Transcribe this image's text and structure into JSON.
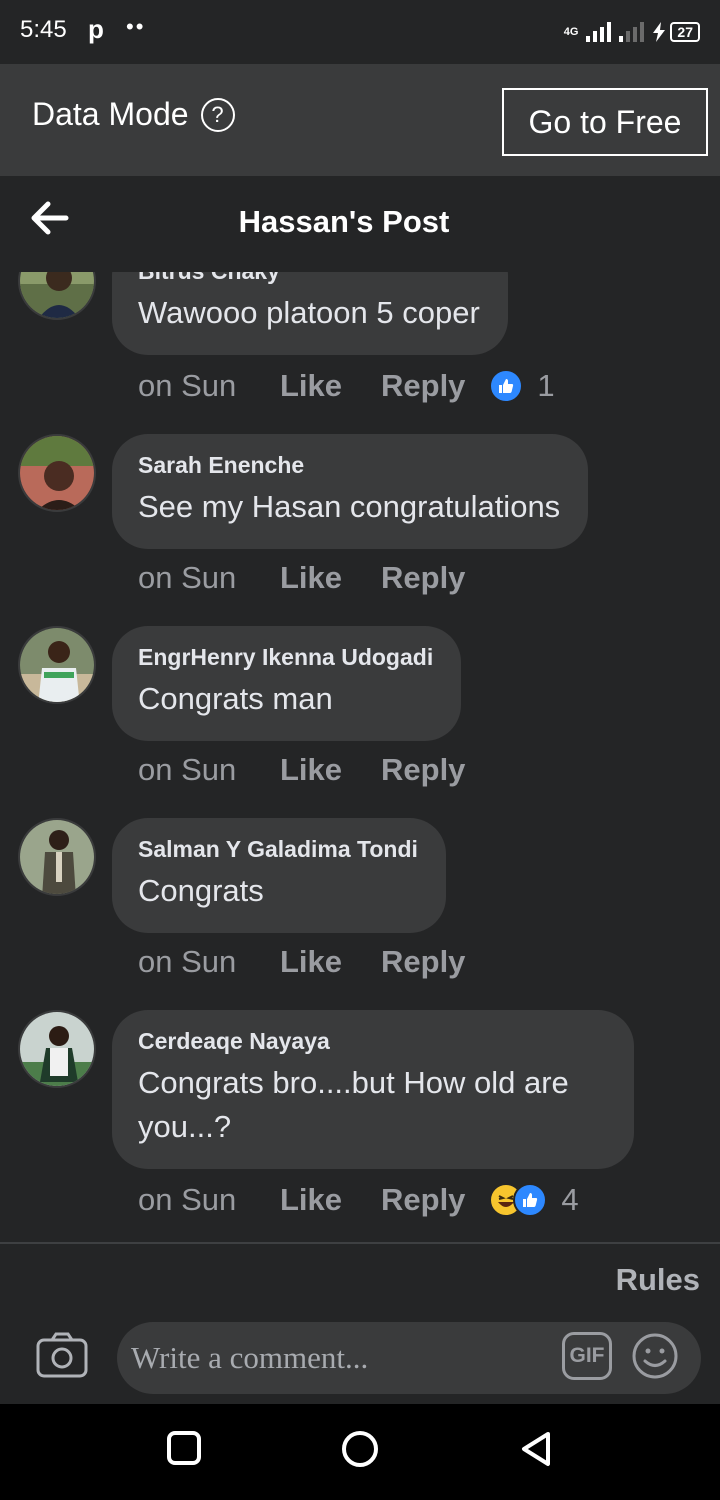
{
  "status_bar": {
    "time": "5:45",
    "app_glyph": "p",
    "dots": "••",
    "network": "4G",
    "battery": "27"
  },
  "data_mode": {
    "label": "Data Mode",
    "help_icon": "help-circle-icon",
    "button": "Go to Free"
  },
  "header": {
    "title": "Hassan's Post",
    "back_icon": "back-arrow-icon"
  },
  "comments": [
    {
      "name": "Bitrus Chaky",
      "text": "Wawooo platoon 5 coper",
      "time": "on Sun",
      "like": "Like",
      "reply": "Reply",
      "reaction_count": "1",
      "reactions": [
        "like"
      ]
    },
    {
      "name": "Sarah Enenche",
      "text": "See my Hasan congratulations",
      "time": "on Sun",
      "like": "Like",
      "reply": "Reply",
      "reaction_count": "",
      "reactions": []
    },
    {
      "name": "EngrHenry Ikenna Udogadi",
      "text": "Congrats man",
      "time": "on Sun",
      "like": "Like",
      "reply": "Reply",
      "reaction_count": "",
      "reactions": []
    },
    {
      "name": "Salman Y Galadima Tondi",
      "text": "Congrats",
      "time": "on Sun",
      "like": "Like",
      "reply": "Reply",
      "reaction_count": "",
      "reactions": []
    },
    {
      "name": "Cerdeaqe Nayaya",
      "text": "Congrats bro....but How old are you...?",
      "time": "on Sun",
      "like": "Like",
      "reply": "Reply",
      "reaction_count": "4",
      "reactions": [
        "haha",
        "like"
      ]
    }
  ],
  "footer": {
    "rules": "Rules",
    "placeholder": "Write a comment...",
    "gif": "GIF",
    "camera_icon": "camera-icon",
    "emoji_icon": "emoji-smile-icon"
  },
  "colors": {
    "background": "#18191a",
    "surface": "#242526",
    "bubble": "#3a3b3c",
    "accent": "#2d88ff",
    "muted_text": "#9a9ca1"
  }
}
